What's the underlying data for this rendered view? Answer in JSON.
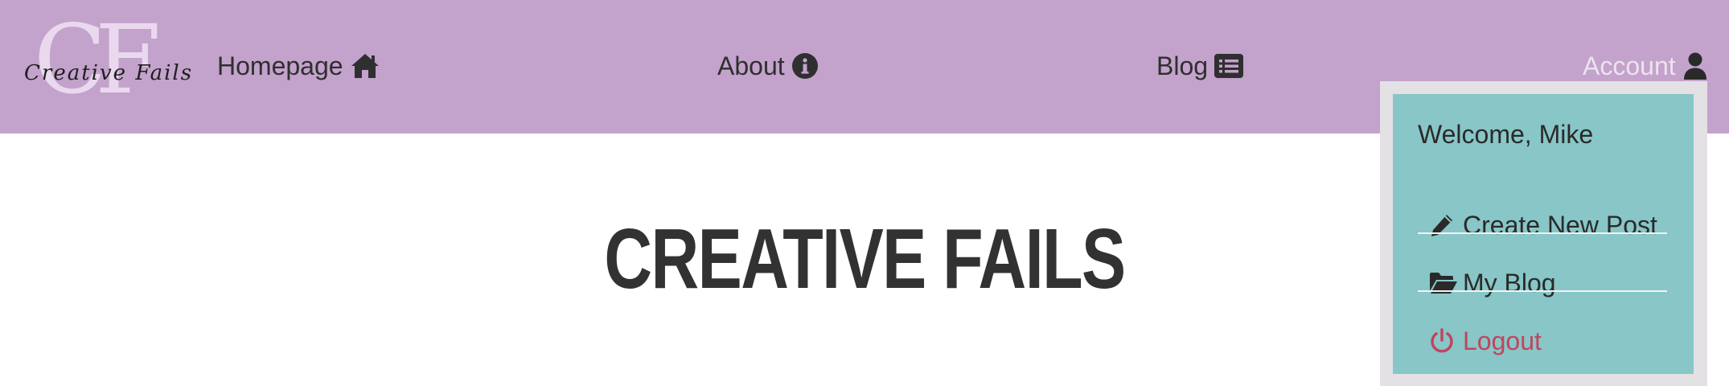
{
  "logo": {
    "monogram": "CF",
    "script_text": "Creative Fails"
  },
  "nav": {
    "home": {
      "label": "Homepage",
      "icon": "home-icon"
    },
    "about": {
      "label": "About",
      "icon": "info-circle-icon"
    },
    "blog": {
      "label": "Blog",
      "icon": "list-alt-icon"
    },
    "account": {
      "label": "Account",
      "icon": "user-icon"
    }
  },
  "account_menu": {
    "welcome": "Welcome, Mike",
    "items": [
      {
        "label": "Create New Post",
        "icon": "pencil-icon"
      },
      {
        "label": "My Blog",
        "icon": "folder-open-icon"
      },
      {
        "label": "Logout",
        "icon": "power-icon"
      }
    ]
  },
  "main": {
    "title": "CREATIVE FAILS"
  },
  "colors": {
    "navbar": "#c3a2cc",
    "dropdown_bg": "#88c6c7",
    "dropdown_frame": "#e3e1e4",
    "logout": "#c2445e",
    "text": "#2f2f2f"
  }
}
